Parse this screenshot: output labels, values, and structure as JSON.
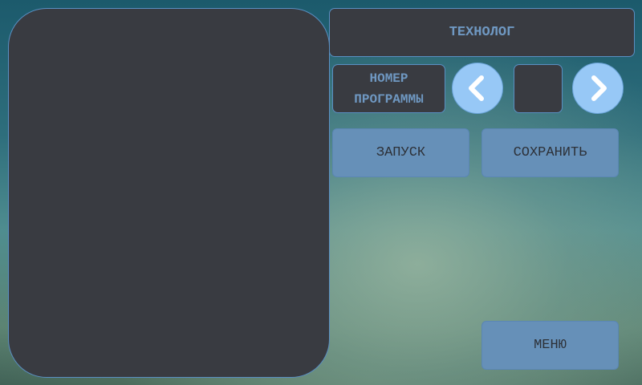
{
  "display": {
    "content": ""
  },
  "header": {
    "title": "ТЕХНОЛОГ"
  },
  "program": {
    "label_line1": "НОМЕР",
    "label_line2": "ПРОГРАММЫ",
    "number": "",
    "prev_icon": "chevron-left-icon",
    "next_icon": "chevron-right-icon"
  },
  "actions": {
    "start_label": "ЗАПУСК",
    "save_label": "СОХРАНИТЬ",
    "menu_label": "МЕНЮ"
  },
  "colors": {
    "panel": "#393b41",
    "panel_border": "#5a8fc2",
    "panel_text": "#6f98c2",
    "button": "#6690b8",
    "round_button": "#97c8f6"
  }
}
